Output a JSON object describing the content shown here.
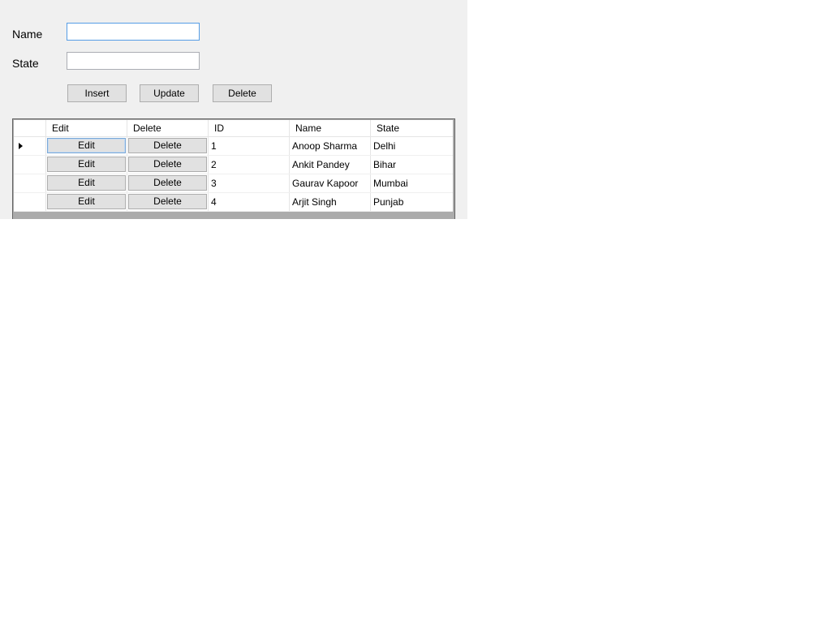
{
  "form": {
    "name_label": "Name",
    "state_label": "State",
    "name_value": "",
    "state_value": "",
    "insert_label": "Insert",
    "update_label": "Update",
    "delete_label": "Delete"
  },
  "grid": {
    "columns": [
      "Edit",
      "Delete",
      "ID",
      "Name",
      "State"
    ],
    "rows": [
      {
        "edit": "Edit",
        "delete": "Delete",
        "id": "1",
        "name": "Anoop Sharma",
        "state": "Delhi"
      },
      {
        "edit": "Edit",
        "delete": "Delete",
        "id": "2",
        "name": "Ankit Pandey",
        "state": "Bihar"
      },
      {
        "edit": "Edit",
        "delete": "Delete",
        "id": "3",
        "name": "Gaurav Kapoor",
        "state": "Mumbai"
      },
      {
        "edit": "Edit",
        "delete": "Delete",
        "id": "4",
        "name": "Arjit Singh",
        "state": "Punjab"
      }
    ]
  }
}
